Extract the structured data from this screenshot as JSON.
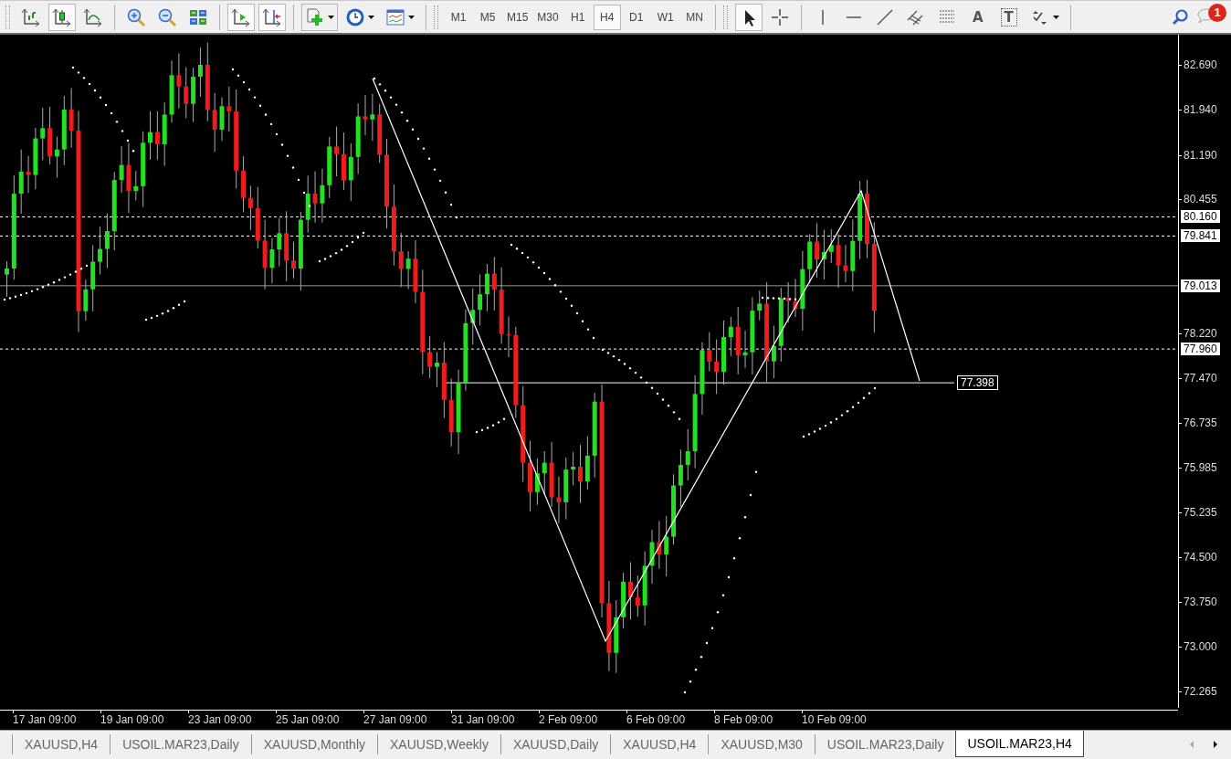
{
  "toolbar": {
    "chart_type_buttons": [
      {
        "selected": false
      },
      {
        "selected": true
      },
      {
        "selected": false
      }
    ],
    "chart_shift_buttons": [
      {
        "selected": true
      },
      {
        "selected": true
      }
    ],
    "timeframes": [
      {
        "label": "M1",
        "selected": false
      },
      {
        "label": "M5",
        "selected": false
      },
      {
        "label": "M15",
        "selected": false
      },
      {
        "label": "M30",
        "selected": false
      },
      {
        "label": "H1",
        "selected": false
      },
      {
        "label": "H4",
        "selected": true
      },
      {
        "label": "D1",
        "selected": false
      },
      {
        "label": "W1",
        "selected": false
      },
      {
        "label": "MN",
        "selected": false
      }
    ],
    "cursor_buttons": [
      {
        "selected": true
      },
      {
        "selected": false
      }
    ],
    "text_tool": "A",
    "label_tool": "T",
    "notification_count": "1"
  },
  "chart": {
    "price_ticks": [
      "82.690",
      "81.940",
      "81.190",
      "80.455",
      "78.220",
      "77.470",
      "76.735",
      "75.985",
      "75.235",
      "74.500",
      "73.750",
      "73.000",
      "72.265"
    ],
    "levels": [
      {
        "kind": "dashed",
        "label": "80.160"
      },
      {
        "kind": "dashed",
        "label": "79.841"
      },
      {
        "kind": "solid",
        "label": "79.013"
      },
      {
        "kind": "dashed",
        "label": "77.960"
      },
      {
        "kind": "segment",
        "label": "77.398"
      }
    ],
    "time_labels": [
      "17 Jan 09:00",
      "19 Jan 09:00",
      "23 Jan 09:00",
      "25 Jan 09:00",
      "27 Jan 09:00",
      "31 Jan 09:00",
      "2 Feb 09:00",
      "6 Feb 09:00",
      "8 Feb 09:00",
      "10 Feb 09:00"
    ]
  },
  "tabs": [
    {
      "label": "XAUUSD,H4",
      "selected": false
    },
    {
      "label": "USOIL.MAR23,Daily",
      "selected": false
    },
    {
      "label": "XAUUSD,Monthly",
      "selected": false
    },
    {
      "label": "XAUUSD,Weekly",
      "selected": false
    },
    {
      "label": "XAUUSD,Daily",
      "selected": false
    },
    {
      "label": "XAUUSD,H4",
      "selected": false
    },
    {
      "label": "XAUUSD,M30",
      "selected": false
    },
    {
      "label": "USOIL.MAR23,Daily",
      "selected": false
    },
    {
      "label": "USOIL.MAR23,H4",
      "selected": true
    }
  ]
}
